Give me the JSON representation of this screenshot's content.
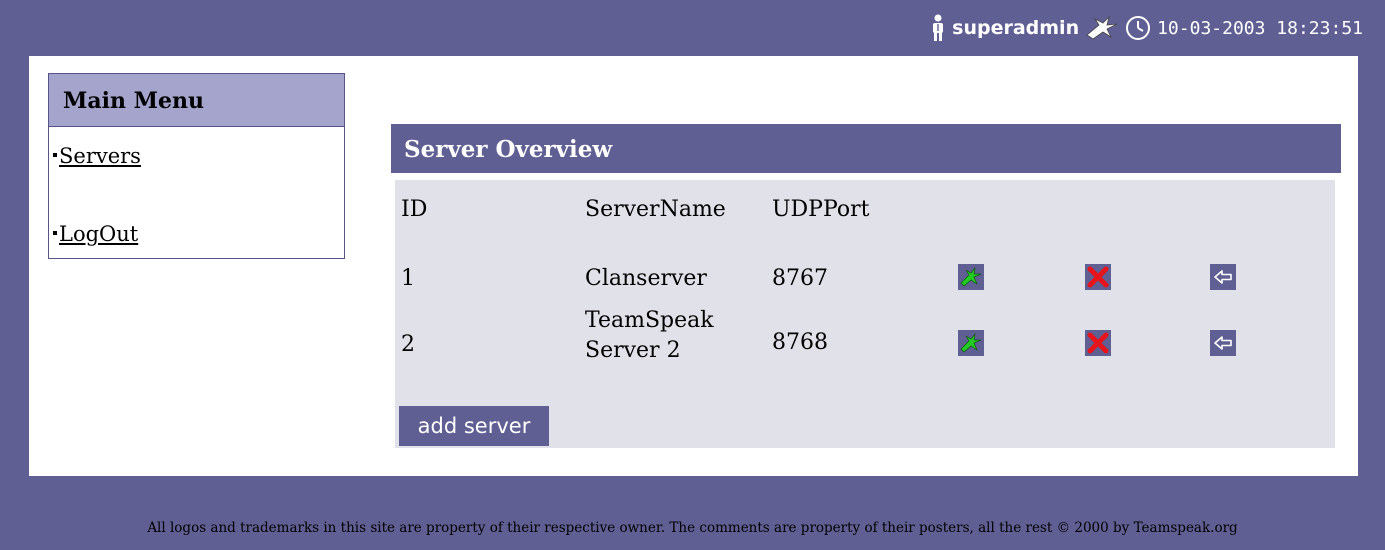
{
  "top_bar": {
    "username": "superadmin",
    "datetime": "10-03-2003 18:23:51",
    "icons": [
      "person-icon",
      "teamspeak-logo-icon",
      "clock-icon"
    ]
  },
  "main_menu": {
    "title": "Main Menu",
    "items": [
      {
        "label": "Servers"
      },
      {
        "label": "LogOut"
      }
    ]
  },
  "server_overview": {
    "title": "Server Overview",
    "columns": [
      "ID",
      "ServerName",
      "UDPPort"
    ],
    "rows": [
      {
        "id": "1",
        "server_name": "Clanserver",
        "udp_port": "8767",
        "actions": [
          "green-teamspeak-icon",
          "red-x-delete-icon",
          "arrow-left-icon"
        ]
      },
      {
        "id": "2",
        "server_name": "TeamSpeak Server 2",
        "udp_port": "8768",
        "actions": [
          "green-teamspeak-icon",
          "red-x-delete-icon",
          "arrow-left-icon"
        ]
      }
    ],
    "add_button_label": "add server"
  },
  "footer": {
    "text": "All logos and trademarks in this site are property of their respective owner.  The comments are property of their posters, all the rest © 2000 by Teamspeak.org"
  },
  "colors": {
    "background": "#5f5f93",
    "menu_title_bg": "#a4a4cc",
    "table_bg": "#e1e1e9",
    "delete_red": "#e8141b",
    "logo_green": "#22cc22"
  }
}
